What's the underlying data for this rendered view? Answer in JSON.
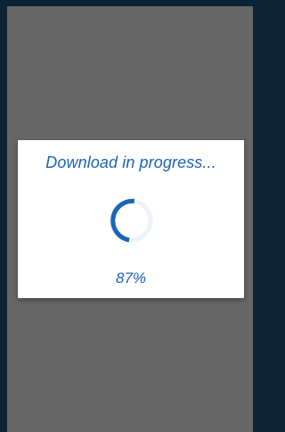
{
  "dialog": {
    "title": "Download in progress...",
    "progress_text": "87%",
    "progress_value": 0.87
  },
  "colors": {
    "accent": "#1a64b4",
    "spinner_track": "#eef3fa",
    "overlay": "#666666",
    "frame": "#0d2436"
  },
  "icons": {
    "spinner": "circular-progress-icon"
  }
}
